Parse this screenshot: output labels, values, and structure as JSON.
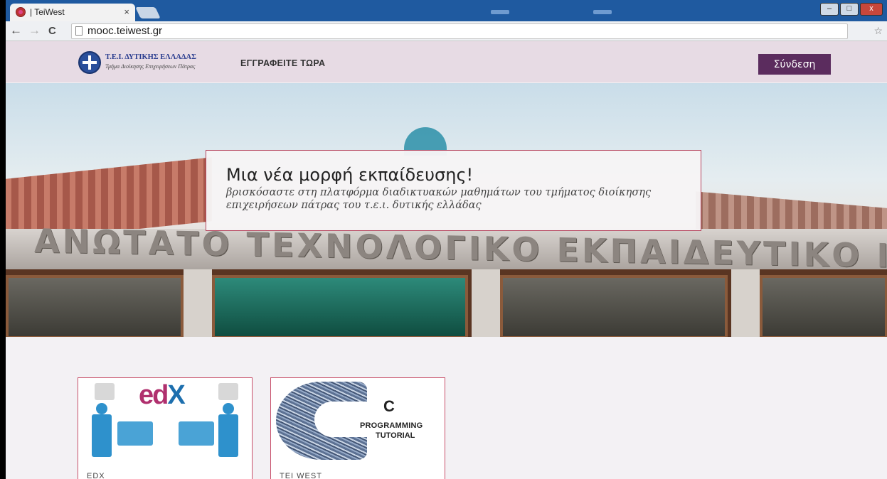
{
  "browser": {
    "tab_title": "| TeiWest",
    "tab_close": "×",
    "url": "mooc.teiwest.gr",
    "back": "←",
    "forward": "→",
    "reload": "C",
    "win_minimize": "–",
    "win_maximize": "□",
    "win_close": "x"
  },
  "header": {
    "logo_line1": "Τ.Ε.Ι. ΔΥΤΙΚΗΣ ΕΛΛΑΔΑΣ",
    "logo_line2": "Τμήμα Διοίκησης Επιχειρήσεων Πάτρας",
    "register_label": "ΕΓΓΡΑΦΕΙΤΕ ΤΩΡΑ",
    "login_label": "Σύνδεση"
  },
  "hero": {
    "title": "Μια νέα μορφή εκπαίδευσης!",
    "subtitle": "βρισκόσαστε στη πλατφόρμα διαδικτυακών μαθημάτων του τμήματος διοίκησης επιχειρήσεων πάτρας του τ.ε.ι. δυτικής ελλάδας",
    "building_inscription": "ΑΝΩΤΑΤΟ ΤΕΧΝΟΛΟΓΙΚΟ ΕΚΠΑΙΔΕΥΤΙΚΟ ΙΔΡΥΜΑ"
  },
  "courses": [
    {
      "label": "EDX",
      "thumb_text_main": "ed",
      "thumb_text_accent": "X"
    },
    {
      "label": "TEI WEST",
      "thumb_text_main": "C",
      "thumb_text_line2": "PROGRAMMING",
      "thumb_text_line3": "TUTORIAL"
    }
  ],
  "colors": {
    "header_bg": "#e7dbe4",
    "login_bg": "#5b2c5e",
    "card_border": "#c8506a",
    "chrome_blue": "#1f5aa0"
  }
}
